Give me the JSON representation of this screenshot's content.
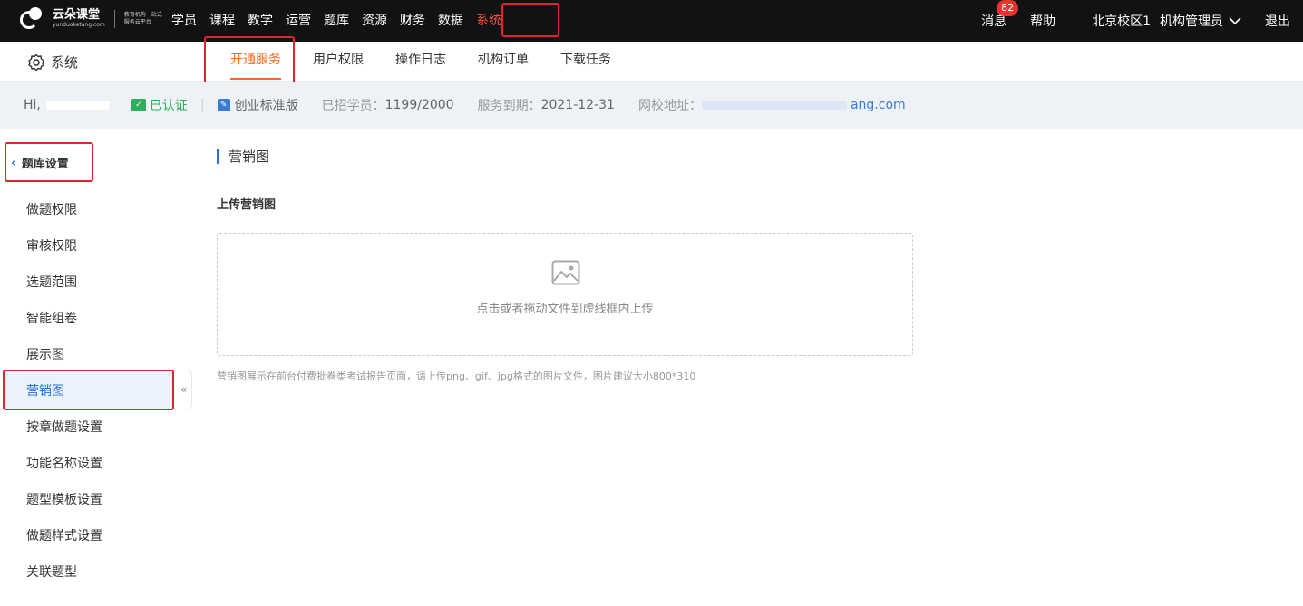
{
  "header": {
    "logo_text": "云朵课堂",
    "logo_sub": "yunduoketang.com",
    "logo_slogan": "教育机构一站式服务云平台",
    "nav": [
      {
        "label": "学员"
      },
      {
        "label": "课程"
      },
      {
        "label": "教学"
      },
      {
        "label": "运营"
      },
      {
        "label": "题库"
      },
      {
        "label": "资源"
      },
      {
        "label": "财务"
      },
      {
        "label": "数据"
      },
      {
        "label": "系统",
        "active": true
      }
    ],
    "messages_label": "消息",
    "messages_count": "82",
    "help_label": "帮助",
    "campus": "北京校区1",
    "user_role": "机构管理员",
    "logout_label": "退出"
  },
  "subnav": {
    "section_title": "系统",
    "tabs": [
      {
        "label": "开通服务",
        "active": true
      },
      {
        "label": "用户权限"
      },
      {
        "label": "操作日志"
      },
      {
        "label": "机构订单"
      },
      {
        "label": "下载任务"
      }
    ]
  },
  "infobar": {
    "greeting": "Hi,",
    "verified_label": "已认证",
    "edition": "创业标准版",
    "students_label": "已招学员：",
    "students_value": "1199/2000",
    "expiry_label": "服务到期：",
    "expiry_value": "2021-12-31",
    "site_label": "网校地址：",
    "site_value": "ang.com"
  },
  "sidebar": {
    "back_title": "题库设置",
    "items": [
      {
        "label": "做题权限"
      },
      {
        "label": "审核权限"
      },
      {
        "label": "选题范围"
      },
      {
        "label": "智能组卷"
      },
      {
        "label": "展示图"
      },
      {
        "label": "营销图",
        "active": true
      },
      {
        "label": "按章做题设置"
      },
      {
        "label": "功能名称设置"
      },
      {
        "label": "题型模板设置"
      },
      {
        "label": "做题样式设置"
      },
      {
        "label": "关联题型"
      }
    ],
    "collapse_glyph": "«"
  },
  "main": {
    "section_title": "营销图",
    "upload_label": "上传营销图",
    "drop_text": "点击或者拖动文件到虚线框内上传",
    "hint": "营销图展示在前台付费批卷类考试报告页面，请上传png、gif、jpg格式的图片文件，图片建议大小800*310"
  },
  "colors": {
    "topbar_bg": "#111214",
    "active_nav": "#ff4d3a",
    "accent_orange": "#ff6a1a",
    "accent_blue": "#2a6fd6",
    "highlight_box": "#e0252f"
  }
}
